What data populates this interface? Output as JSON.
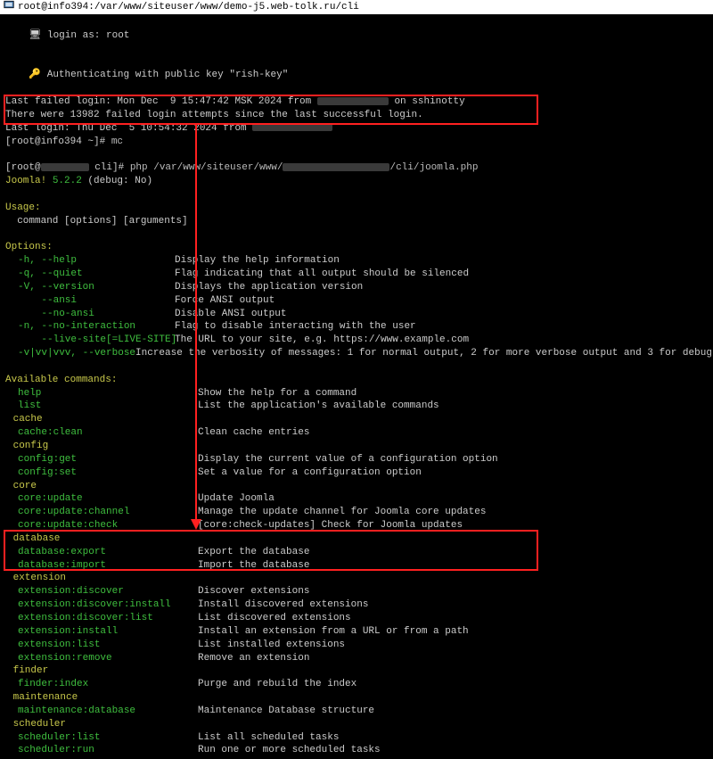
{
  "titlebar": "root@info394:/var/www/siteuser/www/demo-j5.web-tolk.ru/cli",
  "login": {
    "line1": "login as: root",
    "line2": "Authenticating with public key \"rish-key\"",
    "line3_a": "Last failed login: Mon Dec  9 15:47:42 MSK 2024 from ",
    "line3_b": " on sshinotty",
    "line4": "There were 13982 failed login attempts since the last successful login.",
    "line5_a": "Last login: Thu Dec  5 10:54:32 2024 from ",
    "prompt1": "[root@info394 ~]# ",
    "mc": "mc"
  },
  "cmdline": {
    "prompt_a": "[root@",
    "prompt_b": " cli]# ",
    "cmd_a": "php /var/www/siteuser/www/",
    "cmd_b": "/cli/joomla.php"
  },
  "joomla": {
    "name": "Joomla!",
    "ver": " 5.2.2",
    "debug": " (debug: No)"
  },
  "usage": {
    "title": "Usage:",
    "body": "  command [options] [arguments]"
  },
  "options_title": "Options:",
  "options": [
    {
      "k": "-h, --help",
      "d": "Display the help information"
    },
    {
      "k": "-q, --quiet",
      "d": "Flag indicating that all output should be silenced"
    },
    {
      "k": "-V, --version",
      "d": "Displays the application version"
    },
    {
      "k": "    --ansi",
      "d": "Force ANSI output"
    },
    {
      "k": "    --no-ansi",
      "d": "Disable ANSI output"
    },
    {
      "k": "-n, --no-interaction",
      "d": "Flag to disable interacting with the user"
    },
    {
      "k": "    --live-site[=LIVE-SITE]",
      "d": "The URL to your site, e.g. https://www.example.com"
    },
    {
      "k": "-v|vv|vvv, --verbose",
      "d": "Increase the verbosity of messages: 1 for normal output, 2 for more verbose output and 3 for debug"
    }
  ],
  "avail_title": "Available commands:",
  "groups": [
    {
      "name": "",
      "cmds": [
        {
          "k": "help",
          "d": "Show the help for a command"
        },
        {
          "k": "list",
          "d": "List the application's available commands"
        }
      ]
    },
    {
      "name": "cache",
      "cmds": [
        {
          "k": "cache:clean",
          "d": "Clean cache entries"
        }
      ]
    },
    {
      "name": "config",
      "cmds": [
        {
          "k": "config:get",
          "d": "Display the current value of a configuration option"
        },
        {
          "k": "config:set",
          "d": "Set a value for a configuration option"
        }
      ]
    },
    {
      "name": "core",
      "cmds": [
        {
          "k": "core:update",
          "d": "Update Joomla"
        },
        {
          "k": "core:update:channel",
          "d": "Manage the update channel for Joomla core updates"
        },
        {
          "k": "core:update:check",
          "d": "[core:check-updates] Check for Joomla updates"
        }
      ]
    },
    {
      "name": "database",
      "cmds": [
        {
          "k": "database:export",
          "d": "Export the database"
        },
        {
          "k": "database:import",
          "d": "Import the database"
        }
      ]
    },
    {
      "name": "extension",
      "cmds": [
        {
          "k": "extension:discover",
          "d": "Discover extensions"
        },
        {
          "k": "extension:discover:install",
          "d": "Install discovered extensions"
        },
        {
          "k": "extension:discover:list",
          "d": "List discovered extensions"
        },
        {
          "k": "extension:install",
          "d": "Install an extension from a URL or from a path"
        },
        {
          "k": "extension:list",
          "d": "List installed extensions"
        },
        {
          "k": "extension:remove",
          "d": "Remove an extension"
        }
      ]
    },
    {
      "name": "finder",
      "cmds": [
        {
          "k": "finder:index",
          "d": "Purge and rebuild the index"
        }
      ]
    },
    {
      "name": "maintenance",
      "cmds": [
        {
          "k": "maintenance:database",
          "d": "Maintenance Database structure"
        }
      ]
    },
    {
      "name": "scheduler",
      "cmds": [
        {
          "k": "scheduler:list",
          "d": "List all scheduled tasks"
        },
        {
          "k": "scheduler:run",
          "d": "Run one or more scheduled tasks"
        }
      ]
    }
  ]
}
